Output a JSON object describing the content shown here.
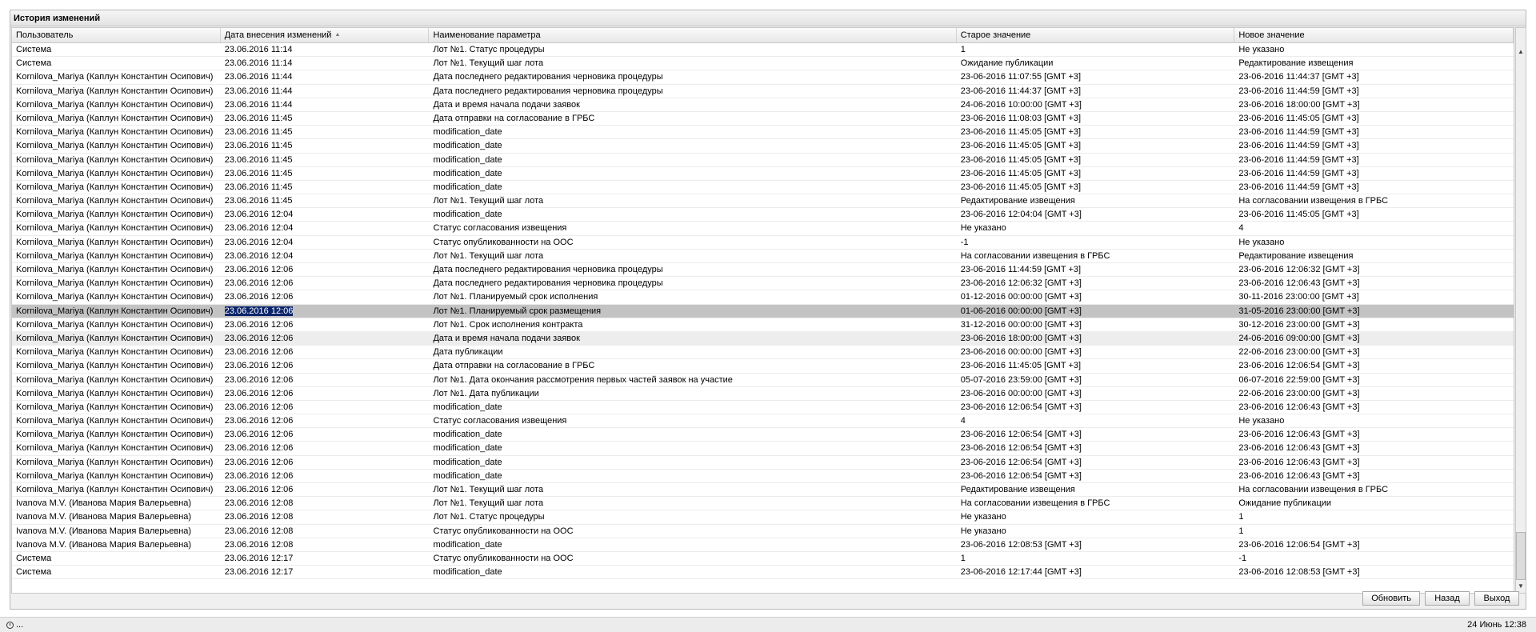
{
  "panel": {
    "title": "История изменений"
  },
  "columns": [
    "Пользователь",
    "Дата внесения изменений",
    "Наименование параметра",
    "Старое значение",
    "Новое значение"
  ],
  "rows": [
    [
      "Система",
      "23.06.2016 11:14",
      "Лот №1. Статус процедуры",
      "1",
      "Не указано"
    ],
    [
      "Система",
      "23.06.2016 11:14",
      "Лот №1. Текущий шаг лота",
      "Ожидание публикации",
      "Редактирование извещения"
    ],
    [
      "Kornilova_Mariya (Каплун Константин Осипович)",
      "23.06.2016 11:44",
      "Дата последнего редактирования черновика процедуры",
      "23-06-2016 11:07:55 [GMT +3]",
      "23-06-2016 11:44:37 [GMT +3]"
    ],
    [
      "Kornilova_Mariya (Каплун Константин Осипович)",
      "23.06.2016 11:44",
      "Дата последнего редактирования черновика процедуры",
      "23-06-2016 11:44:37 [GMT +3]",
      "23-06-2016 11:44:59 [GMT +3]"
    ],
    [
      "Kornilova_Mariya (Каплун Константин Осипович)",
      "23.06.2016 11:44",
      "Дата и время начала подачи заявок",
      "24-06-2016 10:00:00 [GMT +3]",
      "23-06-2016 18:00:00 [GMT +3]"
    ],
    [
      "Kornilova_Mariya (Каплун Константин Осипович)",
      "23.06.2016 11:45",
      "Дата отправки на согласование в ГРБС",
      "23-06-2016 11:08:03 [GMT +3]",
      "23-06-2016 11:45:05 [GMT +3]"
    ],
    [
      "Kornilova_Mariya (Каплун Константин Осипович)",
      "23.06.2016 11:45",
      "modification_date",
      "23-06-2016 11:45:05 [GMT +3]",
      "23-06-2016 11:44:59 [GMT +3]"
    ],
    [
      "Kornilova_Mariya (Каплун Константин Осипович)",
      "23.06.2016 11:45",
      "modification_date",
      "23-06-2016 11:45:05 [GMT +3]",
      "23-06-2016 11:44:59 [GMT +3]"
    ],
    [
      "Kornilova_Mariya (Каплун Константин Осипович)",
      "23.06.2016 11:45",
      "modification_date",
      "23-06-2016 11:45:05 [GMT +3]",
      "23-06-2016 11:44:59 [GMT +3]"
    ],
    [
      "Kornilova_Mariya (Каплун Константин Осипович)",
      "23.06.2016 11:45",
      "modification_date",
      "23-06-2016 11:45:05 [GMT +3]",
      "23-06-2016 11:44:59 [GMT +3]"
    ],
    [
      "Kornilova_Mariya (Каплун Константин Осипович)",
      "23.06.2016 11:45",
      "modification_date",
      "23-06-2016 11:45:05 [GMT +3]",
      "23-06-2016 11:44:59 [GMT +3]"
    ],
    [
      "Kornilova_Mariya (Каплун Константин Осипович)",
      "23.06.2016 11:45",
      "Лот №1. Текущий шаг лота",
      "Редактирование извещения",
      "На согласовании извещения в ГРБС"
    ],
    [
      "Kornilova_Mariya (Каплун Константин Осипович)",
      "23.06.2016 12:04",
      "modification_date",
      "23-06-2016 12:04:04 [GMT +3]",
      "23-06-2016 11:45:05 [GMT +3]"
    ],
    [
      "Kornilova_Mariya (Каплун Константин Осипович)",
      "23.06.2016 12:04",
      "Статус согласования извещения",
      "Не указано",
      "4"
    ],
    [
      "Kornilova_Mariya (Каплун Константин Осипович)",
      "23.06.2016 12:04",
      "Статус опубликованности на ООС",
      "-1",
      "Не указано"
    ],
    [
      "Kornilova_Mariya (Каплун Константин Осипович)",
      "23.06.2016 12:04",
      "Лот №1. Текущий шаг лота",
      "На согласовании извещения в ГРБС",
      "Редактирование извещения"
    ],
    [
      "Kornilova_Mariya (Каплун Константин Осипович)",
      "23.06.2016 12:06",
      "Дата последнего редактирования черновика процедуры",
      "23-06-2016 11:44:59 [GMT +3]",
      "23-06-2016 12:06:32 [GMT +3]"
    ],
    [
      "Kornilova_Mariya (Каплун Константин Осипович)",
      "23.06.2016 12:06",
      "Дата последнего редактирования черновика процедуры",
      "23-06-2016 12:06:32 [GMT +3]",
      "23-06-2016 12:06:43 [GMT +3]"
    ],
    [
      "Kornilova_Mariya (Каплун Константин Осипович)",
      "23.06.2016 12:06",
      "Лот №1. Планируемый срок исполнения",
      "01-12-2016 00:00:00 [GMT +3]",
      "30-11-2016 23:00:00 [GMT +3]"
    ],
    [
      "Kornilova_Mariya (Каплун Константин Осипович)",
      "23.06.2016 12:06",
      "Лот №1. Планируемый срок размещения",
      "01-06-2016 00:00:00 [GMT +3]",
      "31-05-2016 23:00:00 [GMT +3]"
    ],
    [
      "Kornilova_Mariya (Каплун Константин Осипович)",
      "23.06.2016 12:06",
      "Лот №1. Срок исполнения контракта",
      "31-12-2016 00:00:00 [GMT +3]",
      "30-12-2016 23:00:00 [GMT +3]"
    ],
    [
      "Kornilova_Mariya (Каплун Константин Осипович)",
      "23.06.2016 12:06",
      "Дата и время начала подачи заявок",
      "23-06-2016 18:00:00 [GMT +3]",
      "24-06-2016 09:00:00 [GMT +3]"
    ],
    [
      "Kornilova_Mariya (Каплун Константин Осипович)",
      "23.06.2016 12:06",
      "Дата публикации",
      "23-06-2016 00:00:00 [GMT +3]",
      "22-06-2016 23:00:00 [GMT +3]"
    ],
    [
      "Kornilova_Mariya (Каплун Константин Осипович)",
      "23.06.2016 12:06",
      "Дата отправки на согласование в ГРБС",
      "23-06-2016 11:45:05 [GMT +3]",
      "23-06-2016 12:06:54 [GMT +3]"
    ],
    [
      "Kornilova_Mariya (Каплун Константин Осипович)",
      "23.06.2016 12:06",
      "Лот №1. Дата окончания рассмотрения первых частей заявок на участие",
      "05-07-2016 23:59:00 [GMT +3]",
      "06-07-2016 22:59:00 [GMT +3]"
    ],
    [
      "Kornilova_Mariya (Каплун Константин Осипович)",
      "23.06.2016 12:06",
      "Лот №1. Дата публикации",
      "23-06-2016 00:00:00 [GMT +3]",
      "22-06-2016 23:00:00 [GMT +3]"
    ],
    [
      "Kornilova_Mariya (Каплун Константин Осипович)",
      "23.06.2016 12:06",
      "modification_date",
      "23-06-2016 12:06:54 [GMT +3]",
      "23-06-2016 12:06:43 [GMT +3]"
    ],
    [
      "Kornilova_Mariya (Каплун Константин Осипович)",
      "23.06.2016 12:06",
      "Статус согласования извещения",
      "4",
      "Не указано"
    ],
    [
      "Kornilova_Mariya (Каплун Константин Осипович)",
      "23.06.2016 12:06",
      "modification_date",
      "23-06-2016 12:06:54 [GMT +3]",
      "23-06-2016 12:06:43 [GMT +3]"
    ],
    [
      "Kornilova_Mariya (Каплун Константин Осипович)",
      "23.06.2016 12:06",
      "modification_date",
      "23-06-2016 12:06:54 [GMT +3]",
      "23-06-2016 12:06:43 [GMT +3]"
    ],
    [
      "Kornilova_Mariya (Каплун Константин Осипович)",
      "23.06.2016 12:06",
      "modification_date",
      "23-06-2016 12:06:54 [GMT +3]",
      "23-06-2016 12:06:43 [GMT +3]"
    ],
    [
      "Kornilova_Mariya (Каплун Константин Осипович)",
      "23.06.2016 12:06",
      "modification_date",
      "23-06-2016 12:06:54 [GMT +3]",
      "23-06-2016 12:06:43 [GMT +3]"
    ],
    [
      "Kornilova_Mariya (Каплун Константин Осипович)",
      "23.06.2016 12:06",
      "Лот №1. Текущий шаг лота",
      "Редактирование извещения",
      "На согласовании извещения в ГРБС"
    ],
    [
      "Ivanova M.V. (Иванова Мария Валерьевна)",
      "23.06.2016 12:08",
      "Лот №1. Текущий шаг лота",
      "На согласовании извещения в ГРБС",
      "Ожидание публикации"
    ],
    [
      "Ivanova M.V. (Иванова Мария Валерьевна)",
      "23.06.2016 12:08",
      "Лот №1. Статус процедуры",
      "Не указано",
      "1"
    ],
    [
      "Ivanova M.V. (Иванова Мария Валерьевна)",
      "23.06.2016 12:08",
      "Статус опубликованности на ООС",
      "Не указано",
      "1"
    ],
    [
      "Ivanova M.V. (Иванова Мария Валерьевна)",
      "23.06.2016 12:08",
      "modification_date",
      "23-06-2016 12:08:53 [GMT +3]",
      "23-06-2016 12:06:54 [GMT +3]"
    ],
    [
      "Система",
      "23.06.2016 12:17",
      "Статус опубликованности на ООС",
      "1",
      "-1"
    ],
    [
      "Система",
      "23.06.2016 12:17",
      "modification_date",
      "23-06-2016 12:17:44 [GMT +3]",
      "23-06-2016 12:08:53 [GMT +3]"
    ]
  ],
  "selected_row": 19,
  "hover_row": 21,
  "buttons": {
    "refresh": "Обновить",
    "back": "Назад",
    "exit": "Выход"
  },
  "status": {
    "left": "...",
    "right": "24 Июнь 12:38"
  },
  "icons": {
    "sort": "sort-ascending-icon",
    "scroll_up": "arrow-up-icon",
    "scroll_down": "arrow-down-icon",
    "status": "clock-icon"
  }
}
